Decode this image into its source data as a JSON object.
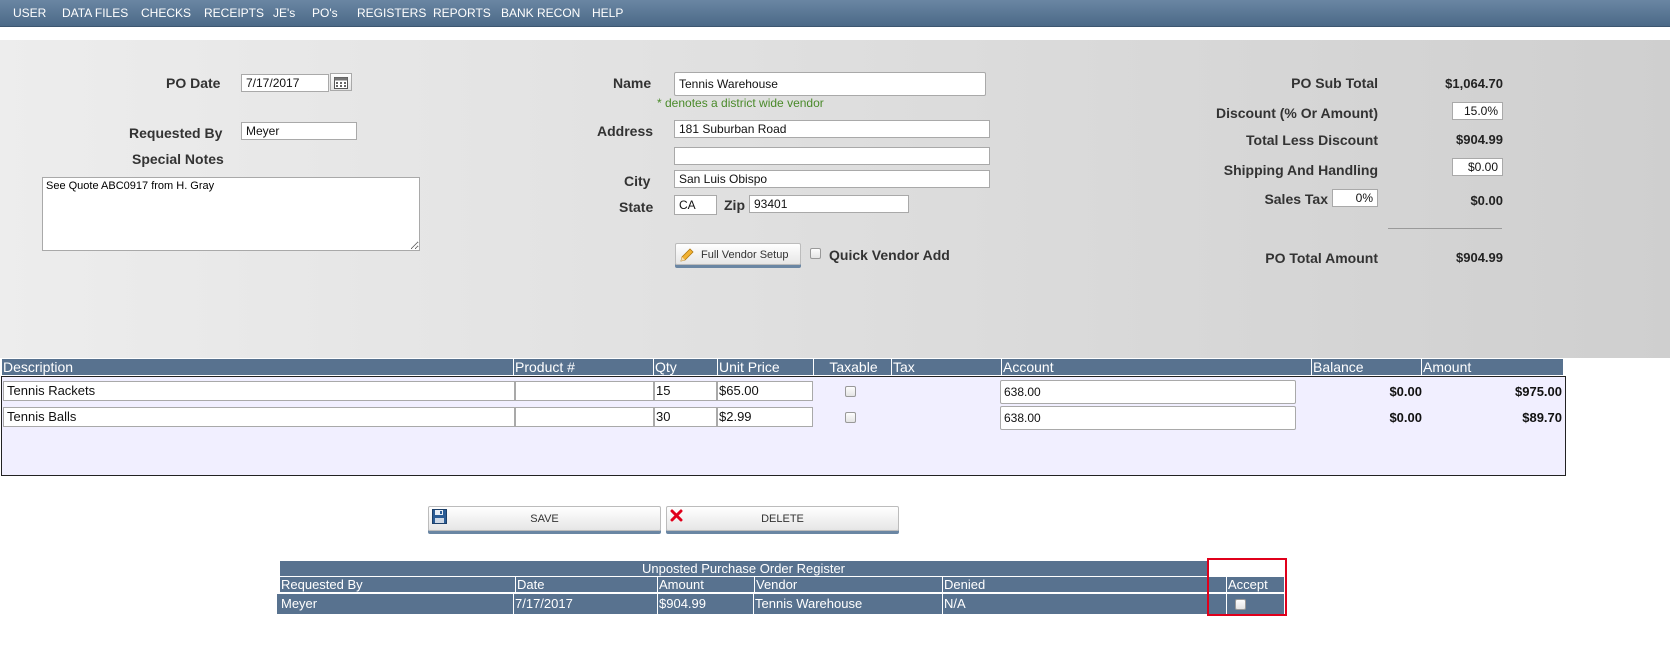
{
  "menu": [
    "USER",
    "DATA FILES",
    "CHECKS",
    "RECEIPTS",
    "JE's",
    "PO's",
    "REGISTERS",
    "REPORTS",
    "BANK RECON",
    "HELP"
  ],
  "form": {
    "po_date_label": "PO Date",
    "po_date_value": "7/17/2017",
    "requested_by_label": "Requested By",
    "requested_by_value": "Meyer",
    "special_notes_label": "Special Notes",
    "special_notes_value": "See Quote ABC0917 from H. Gray",
    "name_label": "Name",
    "name_value": "Tennis Warehouse",
    "district_note": "* denotes a district wide vendor",
    "address_label": "Address",
    "address1_value": "181 Suburban Road",
    "address2_value": "",
    "city_label": "City",
    "city_value": "San Luis Obispo",
    "state_label": "State",
    "state_value": "CA",
    "zip_label": "Zip",
    "zip_value": "93401",
    "full_vendor_setup_label": "Full Vendor Setup",
    "quick_vendor_add_label": "Quick Vendor Add"
  },
  "totals": {
    "sub_total_label": "PO Sub Total",
    "sub_total_value": "$1,064.70",
    "discount_label": "Discount (% Or Amount)",
    "discount_value": "15.0%",
    "total_less_discount_label": "Total Less Discount",
    "total_less_discount_value": "$904.99",
    "shipping_label": "Shipping And Handling",
    "shipping_value": "$0.00",
    "sales_tax_label": "Sales Tax",
    "sales_tax_rate": "0%",
    "sales_tax_value": "$0.00",
    "po_total_label": "PO Total Amount",
    "po_total_value": "$904.99"
  },
  "lines": {
    "headers": {
      "description": "Description",
      "product": "Product #",
      "qty": "Qty",
      "unit_price": "Unit Price",
      "taxable": "Taxable",
      "tax": "Tax",
      "account": "Account",
      "balance": "Balance",
      "amount": "Amount"
    },
    "rows": [
      {
        "description": "Tennis Rackets",
        "product": "",
        "qty": "15",
        "unit_price": "$65.00",
        "account": "638.00",
        "balance": "$0.00",
        "amount": "$975.00"
      },
      {
        "description": "Tennis Balls",
        "product": "",
        "qty": "30",
        "unit_price": "$2.99",
        "account": "638.00",
        "balance": "$0.00",
        "amount": "$89.70"
      }
    ]
  },
  "actions": {
    "save_label": "SAVE",
    "delete_label": "DELETE"
  },
  "register": {
    "title": "Unposted Purchase Order Register",
    "headers": {
      "requested_by": "Requested By",
      "date": "Date",
      "amount": "Amount",
      "vendor": "Vendor",
      "denied": "Denied",
      "accept": "Accept"
    },
    "rows": [
      {
        "requested_by": "Meyer",
        "date": "7/17/2017",
        "amount": "$904.99",
        "vendor": "Tennis Warehouse",
        "denied": "N/A"
      }
    ]
  },
  "colors": {
    "header_blue": "#58728f",
    "highlight_red": "#e0001b",
    "note_green": "#4a8a2a"
  },
  "icons": [
    "calendar-icon",
    "pencil-icon",
    "floppy-disk-icon",
    "red-x-icon"
  ]
}
